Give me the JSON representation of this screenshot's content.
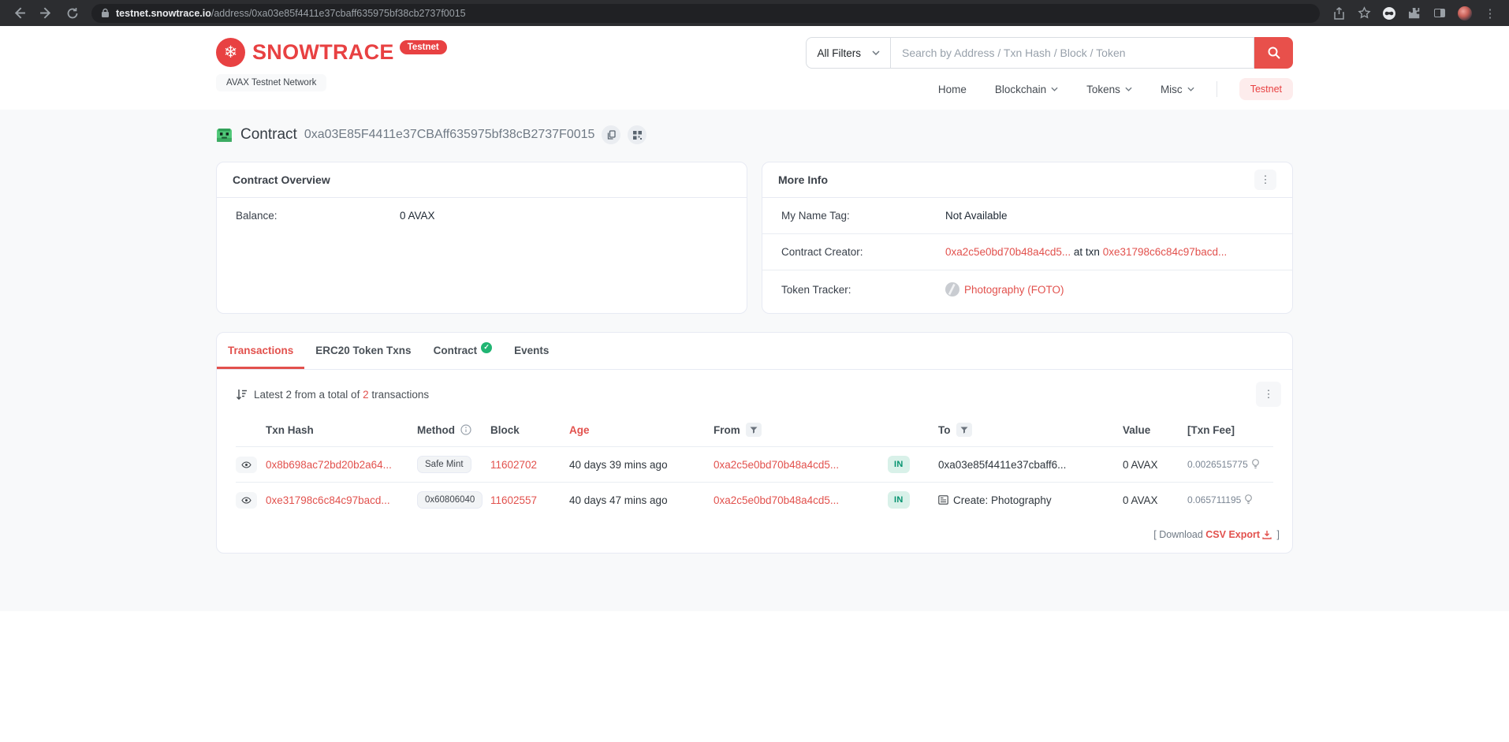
{
  "browser": {
    "url_domain": "testnet.snowtrace.io",
    "url_path": "/address/0xa03e85f4411e37cbaff635975bf38cb2737f0015"
  },
  "header": {
    "brand": "SNOWTRACE",
    "brand_badge": "Testnet",
    "network_label": "AVAX Testnet Network",
    "search": {
      "filter_label": "All Filters",
      "placeholder": "Search by Address / Txn Hash / Block / Token"
    },
    "nav": {
      "home": "Home",
      "blockchain": "Blockchain",
      "tokens": "Tokens",
      "misc": "Misc",
      "testnet": "Testnet"
    }
  },
  "page": {
    "type_label": "Contract",
    "address": "0xa03E85F4411e37CBAff635975bf38cB2737F0015"
  },
  "overview": {
    "title": "Contract Overview",
    "balance_label": "Balance:",
    "balance_value": "0 AVAX"
  },
  "more_info": {
    "title": "More Info",
    "name_tag_label": "My Name Tag:",
    "name_tag_value": "Not Available",
    "creator_label": "Contract Creator:",
    "creator_address": "0xa2c5e0bd70b48a4cd5...",
    "creator_middle": " at txn ",
    "creator_txn": "0xe31798c6c84c97bacd...",
    "tracker_label": "Token Tracker:",
    "tracker_value": "Photography (FOTO)"
  },
  "tabs": [
    "Transactions",
    "ERC20 Token Txns",
    "Contract",
    "Events"
  ],
  "transactions": {
    "summary_prefix": "Latest 2 from a total of ",
    "summary_count": "2",
    "summary_suffix": " transactions",
    "columns": [
      "Txn Hash",
      "Method",
      "Block",
      "Age",
      "From",
      "To",
      "Value",
      "[Txn Fee]"
    ],
    "rows": [
      {
        "hash": "0x8b698ac72bd20b2a64...",
        "method": "Safe Mint",
        "block": "11602702",
        "age": "40 days 39 mins ago",
        "from": "0xa2c5e0bd70b48a4cd5...",
        "direction": "IN",
        "to": "0xa03e85f4411e37cbaff6...",
        "value": "0 AVAX",
        "fee": "0.0026515775"
      },
      {
        "hash": "0xe31798c6c84c97bacd...",
        "method": "0x60806040",
        "block": "11602557",
        "age": "40 days 47 mins ago",
        "from": "0xa2c5e0bd70b48a4cd5...",
        "direction": "IN",
        "to": "Create: Photography",
        "value": "0 AVAX",
        "fee": "0.065711195"
      }
    ],
    "download_prefix": "[ Download ",
    "download_link": "CSV Export",
    "download_suffix": " ]"
  },
  "colors": {
    "brand_red": "#e84142",
    "link_red": "#e2514d",
    "in_badge_bg": "#d9f1e9",
    "in_badge_text": "#05936f",
    "body_bg": "#f8f9fa"
  }
}
